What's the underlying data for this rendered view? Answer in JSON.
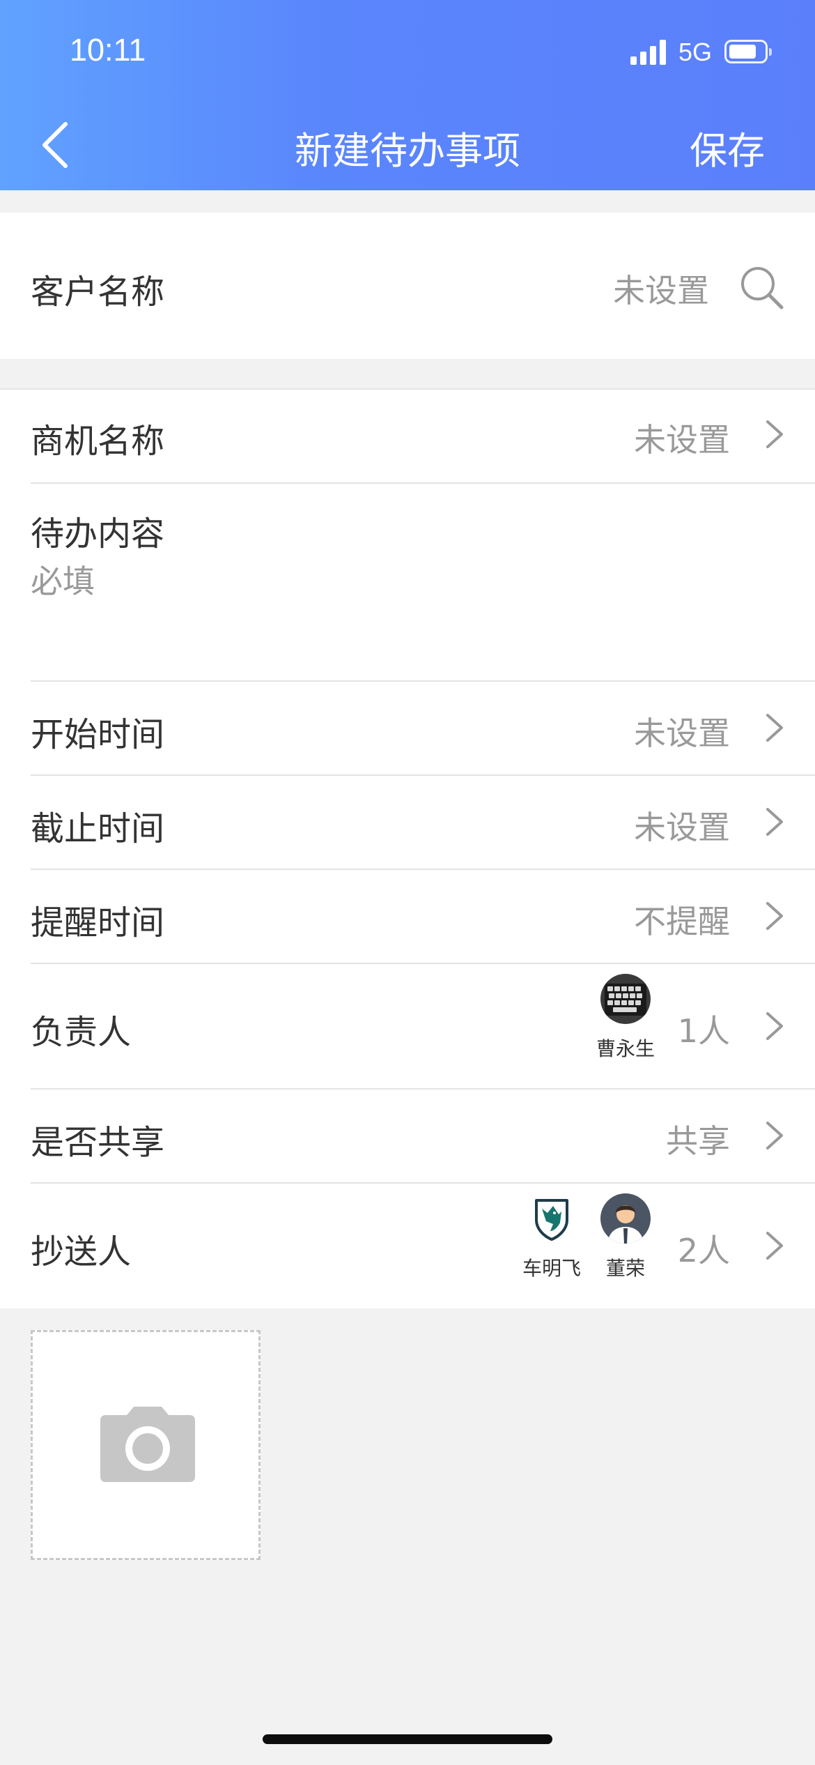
{
  "status_bar": {
    "time": "10:11",
    "network": "5G"
  },
  "nav": {
    "title": "新建待办事项",
    "save_label": "保存"
  },
  "customer": {
    "label": "客户名称",
    "value": "未设置"
  },
  "form": {
    "opportunity": {
      "label": "商机名称",
      "value": "未设置"
    },
    "todo_content": {
      "label": "待办内容",
      "placeholder": "必填"
    },
    "start_time": {
      "label": "开始时间",
      "value": "未设置"
    },
    "end_time": {
      "label": "截止时间",
      "value": "未设置"
    },
    "reminder": {
      "label": "提醒时间",
      "value": "不提醒"
    },
    "owner": {
      "label": "负责人",
      "count": "1人",
      "people": [
        {
          "name": "曹永生",
          "icon": "keyboard-avatar"
        }
      ]
    },
    "share": {
      "label": "是否共享",
      "value": "共享"
    },
    "cc": {
      "label": "抄送人",
      "count": "2人",
      "people": [
        {
          "name": "车明飞",
          "icon": "wolf-shield-avatar"
        },
        {
          "name": "董荣",
          "icon": "person-avatar"
        }
      ]
    }
  },
  "attachment": {
    "icon": "camera-icon"
  },
  "colors": {
    "header_start": "#60a2ff",
    "header_end": "#5b7ffb",
    "background": "#f2f2f2",
    "muted_text": "#999999"
  }
}
